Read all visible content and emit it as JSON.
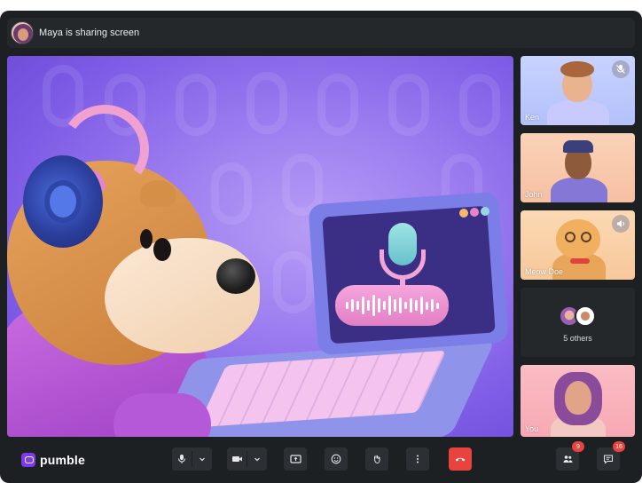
{
  "top_bar": {
    "share_status": "Maya is sharing screen"
  },
  "participants": [
    {
      "name": "Ken",
      "status_icon": "mic-off-icon"
    },
    {
      "name": "John",
      "status_icon": ""
    },
    {
      "name": "Meow Doe",
      "status_icon": "speaker-icon"
    },
    {
      "name": "You",
      "status_icon": ""
    }
  ],
  "others": {
    "label": "5 others"
  },
  "brand": {
    "name": "pumble",
    "color": "#7c3aed"
  },
  "controls": {
    "participants_badge": "9",
    "chat_badge": "16",
    "end_call_color": "#e8433d"
  }
}
